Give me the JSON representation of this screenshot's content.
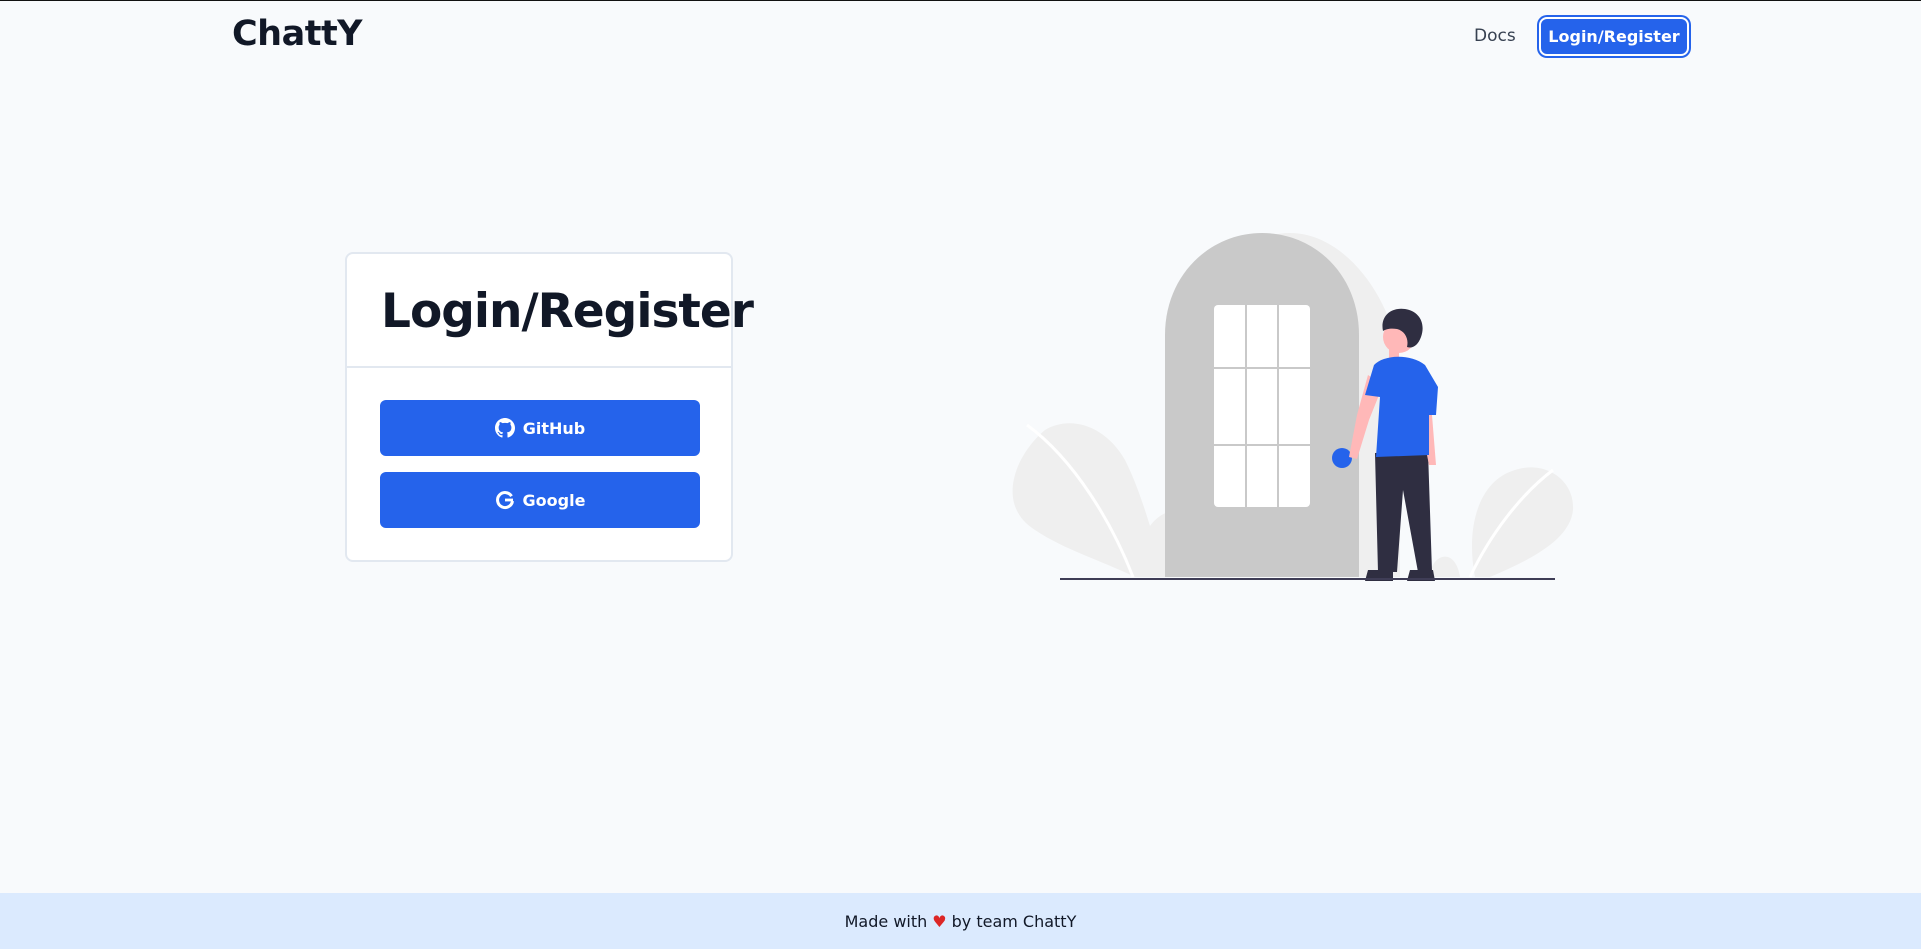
{
  "app": {
    "logo": "ChattY"
  },
  "nav": {
    "docs_label": "Docs",
    "login_label": "Login/Register"
  },
  "card": {
    "title": "Login/Register",
    "buttons": [
      {
        "label": "GitHub",
        "icon": "github-icon"
      },
      {
        "label": "Google",
        "icon": "google-icon"
      }
    ]
  },
  "illustration": {
    "name": "person-at-door-illustration"
  },
  "footer": {
    "prefix": "Made with",
    "heart": "♥",
    "suffix": "by team ChattY"
  },
  "colors": {
    "primary": "#2563eb",
    "background": "#f8fafc",
    "footer_bg": "#dbeafe",
    "heart": "#dc2626"
  }
}
